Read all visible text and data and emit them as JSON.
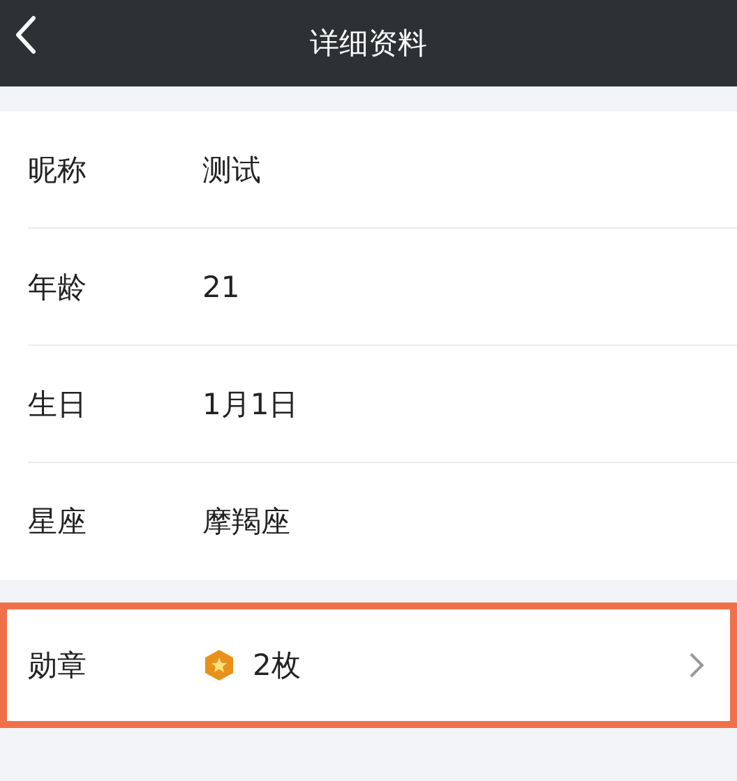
{
  "header": {
    "title": "详细资料"
  },
  "profile_rows": [
    {
      "label": "昵称",
      "value": "测试"
    },
    {
      "label": "年龄",
      "value": "21"
    },
    {
      "label": "生日",
      "value": "1月1日"
    },
    {
      "label": "星座",
      "value": "摩羯座"
    }
  ],
  "medal_row": {
    "label": "勋章",
    "value": "2枚",
    "highlighted": true
  }
}
